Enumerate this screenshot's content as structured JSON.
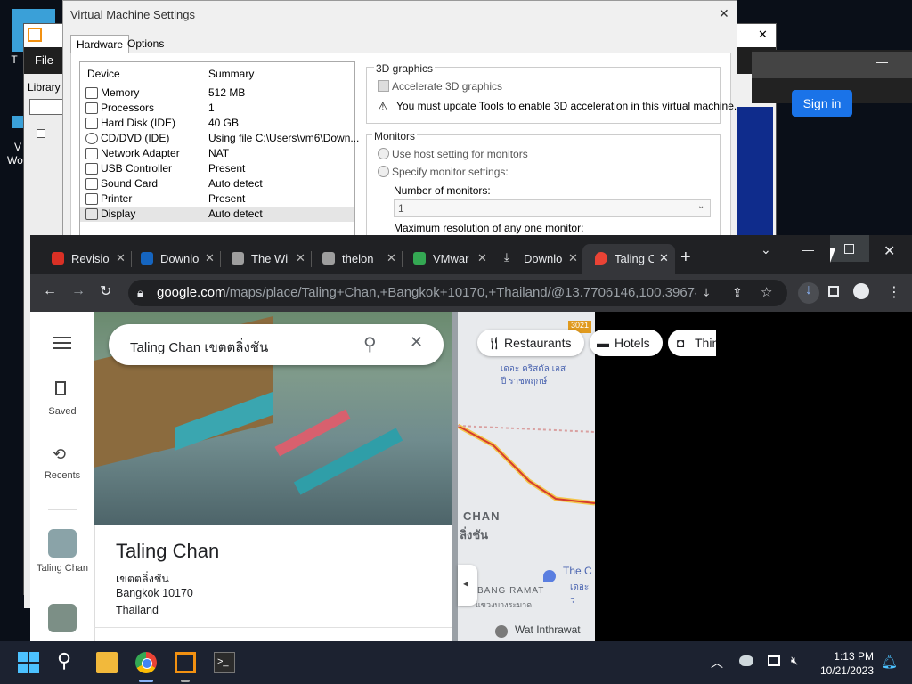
{
  "desktop": {
    "icon_label_1": "T",
    "icon_label_2": "V",
    "icon_label_3": "Wo"
  },
  "vmware": {
    "menu_file": "File",
    "library_label": "Library",
    "close_glyph": "✕",
    "min_glyph": "—"
  },
  "vm_settings": {
    "title": "Virtual Machine Settings",
    "tabs": [
      "Hardware",
      "Options"
    ],
    "columns": {
      "device": "Device",
      "summary": "Summary"
    },
    "rows": [
      {
        "device": "Memory",
        "summary": "512 MB"
      },
      {
        "device": "Processors",
        "summary": "1"
      },
      {
        "device": "Hard Disk (IDE)",
        "summary": "40 GB"
      },
      {
        "device": "CD/DVD (IDE)",
        "summary": "Using file C:\\Users\\vm6\\Down..."
      },
      {
        "device": "Network Adapter",
        "summary": "NAT"
      },
      {
        "device": "USB Controller",
        "summary": "Present"
      },
      {
        "device": "Sound Card",
        "summary": "Auto detect"
      },
      {
        "device": "Printer",
        "summary": "Present"
      },
      {
        "device": "Display",
        "summary": "Auto detect"
      }
    ],
    "graphics": {
      "title": "3D graphics",
      "accelerate": "Accelerate 3D graphics",
      "warning": "You must update Tools to enable 3D acceleration in this virtual machine."
    },
    "monitors": {
      "title": "Monitors",
      "use_host": "Use host setting for monitors",
      "specify": "Specify monitor settings:",
      "number_label": "Number of monitors:",
      "number_value": "1",
      "max_res_label": "Maximum resolution of any one monitor:"
    }
  },
  "chrome": {
    "tabs": [
      {
        "title": "Revision",
        "color": "#d93025"
      },
      {
        "title": "Downlo",
        "color": "#1565c0"
      },
      {
        "title": "The Wi",
        "color": "#9e9e9e"
      },
      {
        "title": "thelon",
        "color": "#9e9e9e"
      },
      {
        "title": "VMwar",
        "color": "#34a853"
      },
      {
        "title": "Downlo",
        "color": "#e8eaed"
      },
      {
        "title": "Taling C",
        "color": "#ea4335"
      }
    ],
    "new_tab": "+",
    "url_host": "google.com",
    "url_rest": "/maps/place/Taling+Chan,+Bangkok+10170,+Thailand/@13.7706146,100.3967421,1..."
  },
  "maps": {
    "saved": "Saved",
    "recents": "Recents",
    "recent_place_1": "Taling Chan",
    "search_text": "Taling Chan เขตตลิ่งชัน",
    "chips": [
      "Restaurants",
      "Hotels",
      "Thin"
    ],
    "sign_in": "Sign in",
    "place": {
      "title": "Taling Chan",
      "thai": "เขตตลิ่งชัน",
      "city": "Bangkok 10170",
      "country": "Thailand"
    },
    "map_labels": {
      "area1": "CHAN",
      "area1_thai": "ลิ่งชัน",
      "poi1": "The C",
      "poi1_sub": "เดอะ ว",
      "area2": "BANG RAMAT",
      "area2_thai": "แขวงบางระมาด",
      "poi2": "Wat Inthrawat",
      "top_poi": "เดอะ คริสตัล เอส\nปี ราชพฤกษ์",
      "road": "3021"
    }
  },
  "taskbar": {
    "time": "1:13 PM",
    "date": "10/21/2023"
  }
}
